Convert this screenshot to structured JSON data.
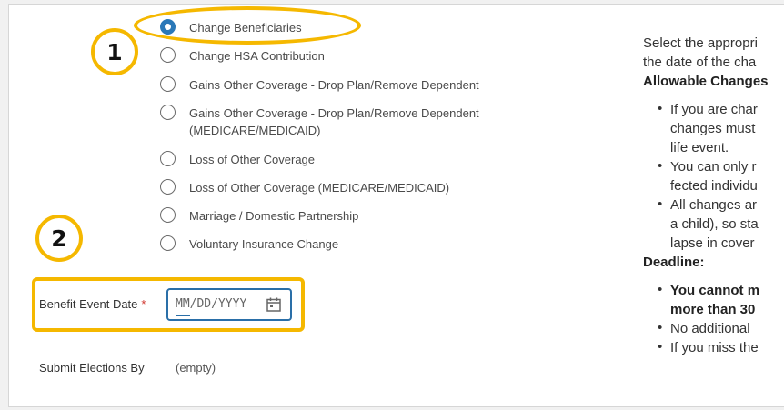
{
  "options": [
    {
      "label": "Change Beneficiaries",
      "selected": true
    },
    {
      "label": "Change HSA Contribution",
      "selected": false
    },
    {
      "label": "Gains Other Coverage - Drop Plan/Remove Dependent",
      "selected": false
    },
    {
      "label": "Gains Other Coverage - Drop Plan/Remove Dependent",
      "label2": "(MEDICARE/MEDICAID)",
      "selected": false
    },
    {
      "label": "Loss of Other Coverage",
      "selected": false
    },
    {
      "label": "Loss of Other Coverage (MEDICARE/MEDICAID)",
      "selected": false
    },
    {
      "label": "Marriage / Domestic Partnership",
      "selected": false
    },
    {
      "label": "Voluntary Insurance Change",
      "selected": false
    }
  ],
  "badges": {
    "one": "1",
    "two": "2"
  },
  "benefit_event": {
    "label": "Benefit Event Date",
    "required_mark": "*",
    "placeholder": "MM/DD/YYYY",
    "icon": "calendar-icon"
  },
  "submit_elections": {
    "label": "Submit Elections By",
    "value": "(empty)"
  },
  "right_panel": {
    "intro_line1": "Select the appropri",
    "intro_line2": "the date of the cha",
    "allowable_heading": "Allowable Changes",
    "bullets": [
      {
        "lines": [
          "If you are char",
          "changes must",
          "life event."
        ]
      },
      {
        "lines": [
          "You can only r",
          "fected individu"
        ]
      },
      {
        "lines": [
          "All changes ar",
          "a child), so sta",
          "lapse in cover"
        ]
      }
    ],
    "deadline_heading": "Deadline:",
    "deadline_bullets": [
      {
        "lines": [
          "You cannot m",
          "more than 30"
        ],
        "bold": true
      },
      {
        "lines": [
          "No additional"
        ],
        "bold": false
      },
      {
        "lines": [
          "If you miss the"
        ],
        "bold": false
      }
    ]
  },
  "colors": {
    "highlight": "#f5b800",
    "radio_selected": "#2a78b8",
    "input_border": "#2a6fa8"
  }
}
